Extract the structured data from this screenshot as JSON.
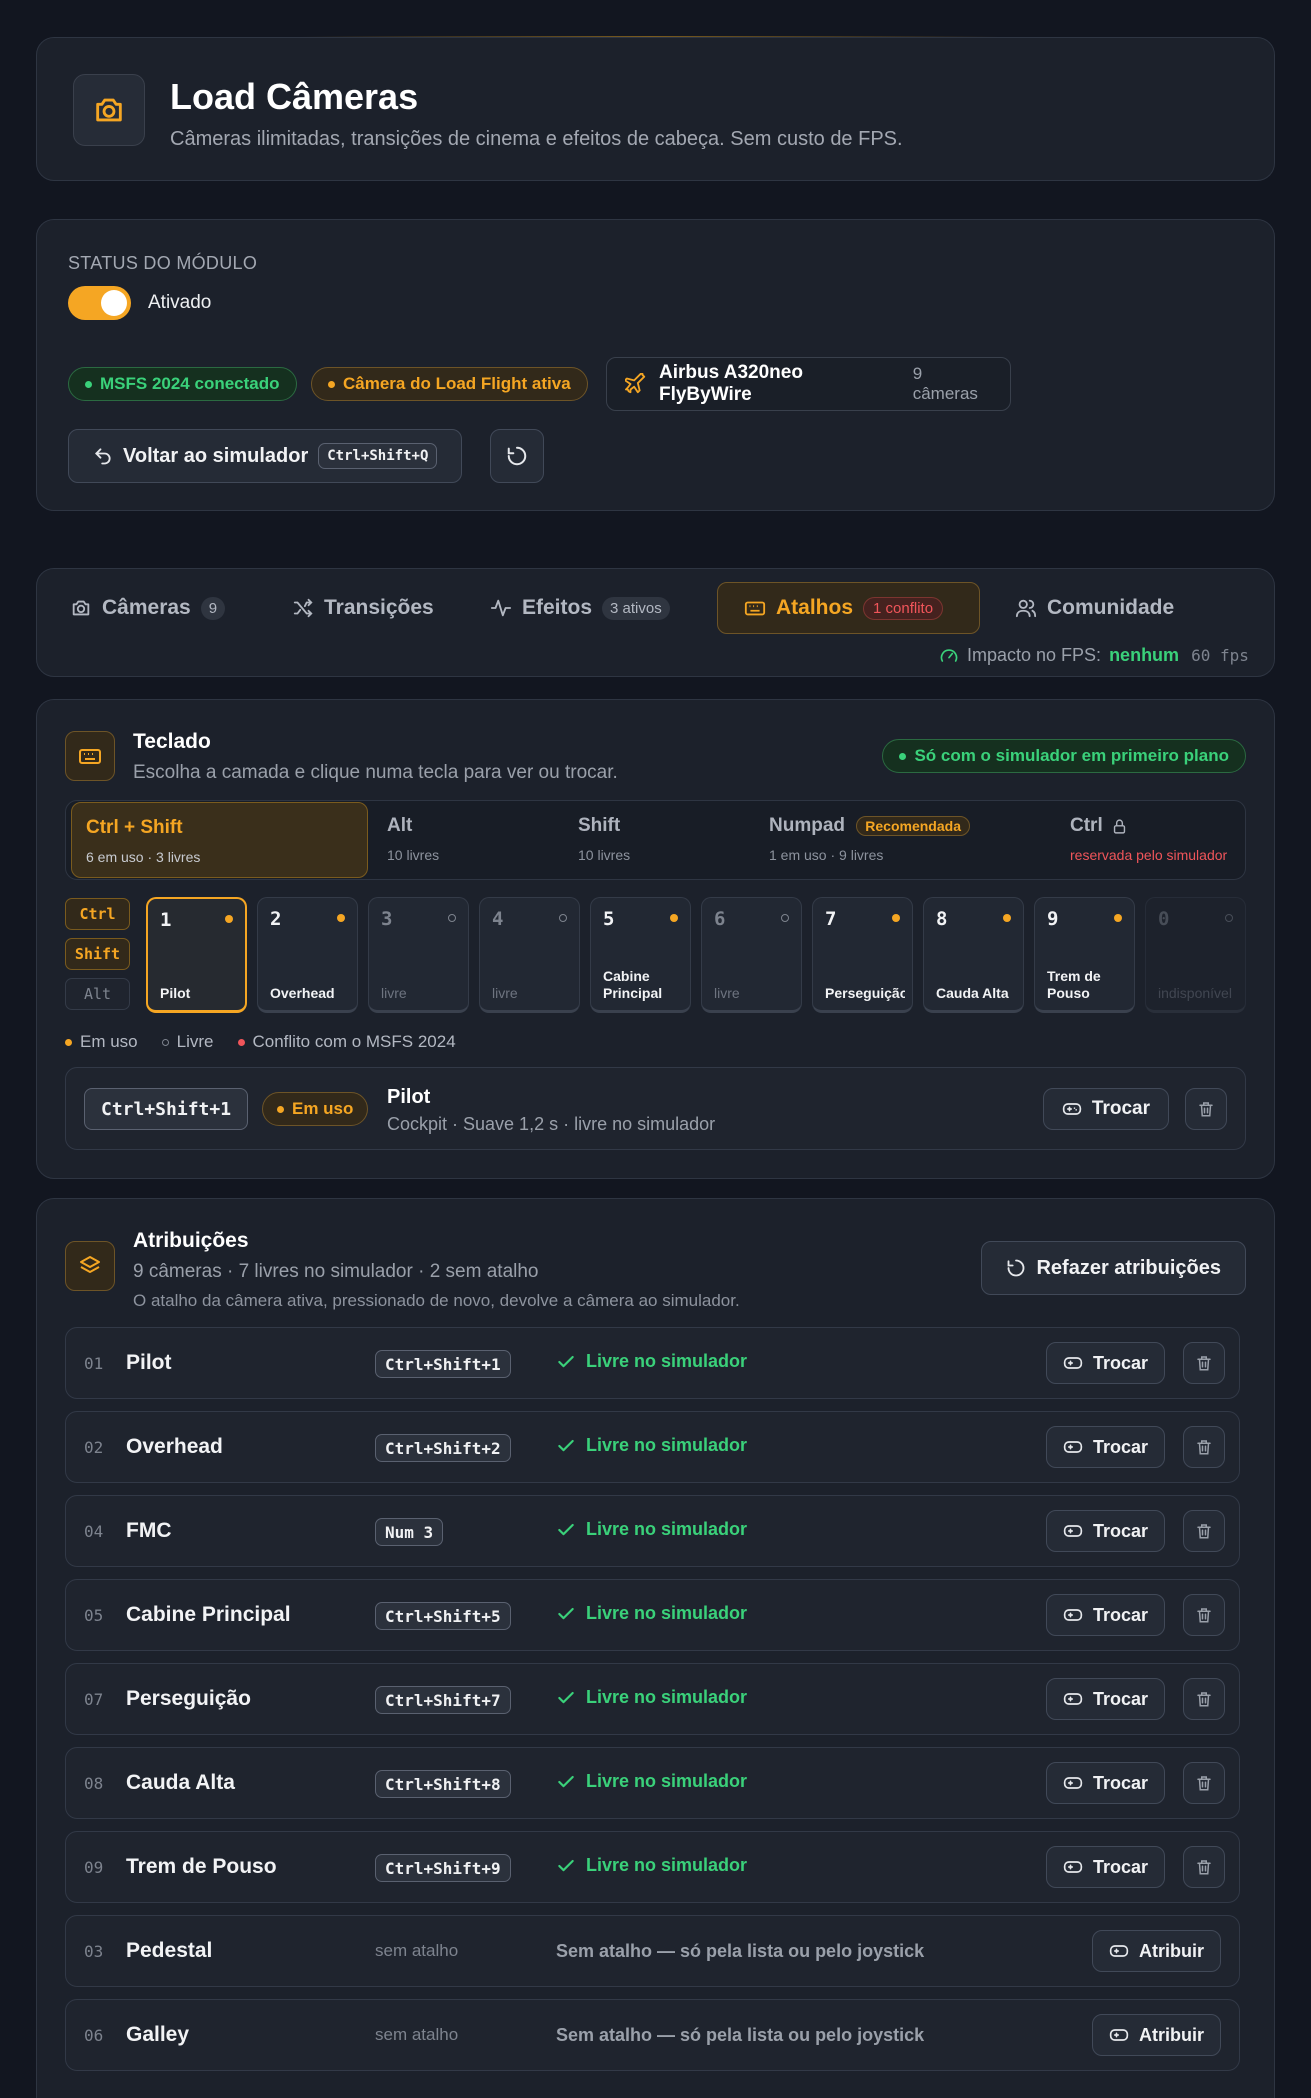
{
  "header": {
    "title": "Load Câmeras",
    "subtitle": "Câmeras ilimitadas, transições de cinema e efeitos de cabeça. Sem custo de FPS.",
    "icon": "camera-icon"
  },
  "status": {
    "label": "STATUS DO MÓDULO",
    "toggle_label": "Ativado",
    "enabled": true,
    "pill_sim": "MSFS 2024 conectado",
    "pill_camera": "Câmera do Load Flight ativa",
    "aircraft_name": "Airbus A320neo FlyByWire",
    "aircraft_cameras": "9 câmeras",
    "back_label": "Voltar ao simulador",
    "back_shortcut": "Ctrl+Shift+Q"
  },
  "tabs": [
    {
      "label": "Câmeras",
      "badge": "9",
      "icon": "camera-icon"
    },
    {
      "label": "Transições",
      "icon": "shuffle-icon"
    },
    {
      "label": "Efeitos",
      "badge": "3 ativos",
      "icon": "pulse-icon"
    },
    {
      "label": "Atalhos",
      "badge": "1 conflito",
      "icon": "keyboard-icon",
      "active": true
    },
    {
      "label": "Comunidade",
      "icon": "users-icon"
    }
  ],
  "fps": {
    "label": "Impacto no FPS:",
    "value": "nenhum",
    "fps": "60 fps"
  },
  "keyboard": {
    "title": "Teclado",
    "subtitle": "Escolha a camada e clique numa tecla para ver ou trocar.",
    "foreground_pill": "Só com o simulador em primeiro plano",
    "layers": [
      {
        "name": "Ctrl + Shift",
        "sub": "6 em uso · 3 livres"
      },
      {
        "name": "Alt",
        "sub": "10 livres"
      },
      {
        "name": "Shift",
        "sub": "10 livres"
      },
      {
        "name": "Numpad",
        "badge": "Recomendada",
        "sub": "1 em uso · 9 livres"
      },
      {
        "name": "Ctrl",
        "sub": "reservada pelo simulador"
      }
    ],
    "modifiers": [
      "Ctrl",
      "Shift",
      "Alt"
    ],
    "keys": [
      {
        "n": "1",
        "label": "Pilot"
      },
      {
        "n": "2",
        "label": "Overhead"
      },
      {
        "n": "3",
        "label": "livre"
      },
      {
        "n": "4",
        "label": "livre"
      },
      {
        "n": "5",
        "label": "Cabine Principal"
      },
      {
        "n": "6",
        "label": "livre"
      },
      {
        "n": "7",
        "label": "Perseguição"
      },
      {
        "n": "8",
        "label": "Cauda Alta"
      },
      {
        "n": "9",
        "label": "Trem de Pouso"
      },
      {
        "n": "0",
        "label": "indisponível"
      }
    ],
    "legend": {
      "used": "Em uso",
      "free": "Livre",
      "conflict": "Conflito com o MSFS 2024"
    },
    "detail": {
      "shortcut": "Ctrl+Shift+1",
      "status": "Em uso",
      "name": "Pilot",
      "desc": "Cockpit · Suave 1,2 s · livre no simulador",
      "swap": "Trocar"
    }
  },
  "assignments": {
    "title": "Atribuições",
    "subtitle": "9 câmeras · 7 livres no simulador · 2 sem atalho",
    "note": "O atalho da câmera ativa, pressionado de novo, devolve a câmera ao simulador.",
    "redo": "Refazer atribuições",
    "swap": "Trocar",
    "assign": "Atribuir",
    "free_text": "Livre no simulador",
    "none_shortcut": "sem atalho",
    "none_text": "Sem atalho — só pela lista ou pelo joystick",
    "rows": [
      {
        "num": "01",
        "name": "Pilot",
        "shortcut": "Ctrl+Shift+1"
      },
      {
        "num": "02",
        "name": "Overhead",
        "shortcut": "Ctrl+Shift+2"
      },
      {
        "num": "04",
        "name": "FMC",
        "shortcut": "Num 3"
      },
      {
        "num": "05",
        "name": "Cabine Principal",
        "shortcut": "Ctrl+Shift+5"
      },
      {
        "num": "07",
        "name": "Perseguição",
        "shortcut": "Ctrl+Shift+7"
      },
      {
        "num": "08",
        "name": "Cauda Alta",
        "shortcut": "Ctrl+Shift+8"
      },
      {
        "num": "09",
        "name": "Trem de Pouso",
        "shortcut": "Ctrl+Shift+9"
      },
      {
        "num": "03",
        "name": "Pedestal"
      },
      {
        "num": "06",
        "name": "Galley"
      }
    ]
  },
  "colors": {
    "accent": "#f5a623",
    "success": "#3ad17a",
    "danger": "#f0555a"
  }
}
